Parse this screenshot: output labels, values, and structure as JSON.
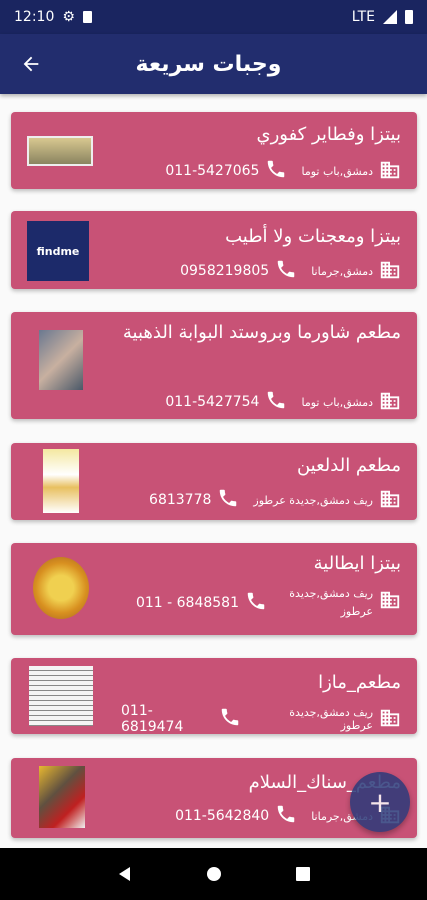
{
  "status": {
    "time": "12:10",
    "network": "LTE"
  },
  "appbar": {
    "title": "وجبات سريعة"
  },
  "restaurants": [
    {
      "name": "بيتزا وفطاير كفوري",
      "address": "دمشق,باب توما",
      "phone": "011-5427065",
      "thumb": "pizza-photo"
    },
    {
      "name": "بيتزا ومعجنات ولا أطيب",
      "address": "دمشق,جرمانا",
      "phone": "0958219805",
      "thumb": "findme-logo",
      "thumb_text": "findme"
    },
    {
      "name": "مطعم شاورما وبروستد البوابة الذهبية",
      "address": "دمشق,باب توما",
      "phone": "011-5427754",
      "thumb": "people-photo"
    },
    {
      "name": "مطعم الدلعين",
      "address": "ريف دمشق,جديدة عرطوز",
      "phone": "6813778",
      "thumb": "menu-flyer"
    },
    {
      "name": "بيتزا ايطالية",
      "address": "ريف دمشق,جديدة عرطوز",
      "phone": "011 - 6848581",
      "thumb": "pizza-photo"
    },
    {
      "name": "مطعم_مازا",
      "address": "ريف دمشق,جديدة عرطوز",
      "phone": "011-6819474",
      "thumb": "menu-sheet"
    },
    {
      "name": "مطعم_سناك_السلام",
      "address": "دمشق,جرمانا",
      "phone": "011-5642840",
      "thumb": "food-photo"
    }
  ],
  "colors": {
    "card": "#c85276",
    "appbar": "#222d6e",
    "statusbar": "#1a2560"
  }
}
